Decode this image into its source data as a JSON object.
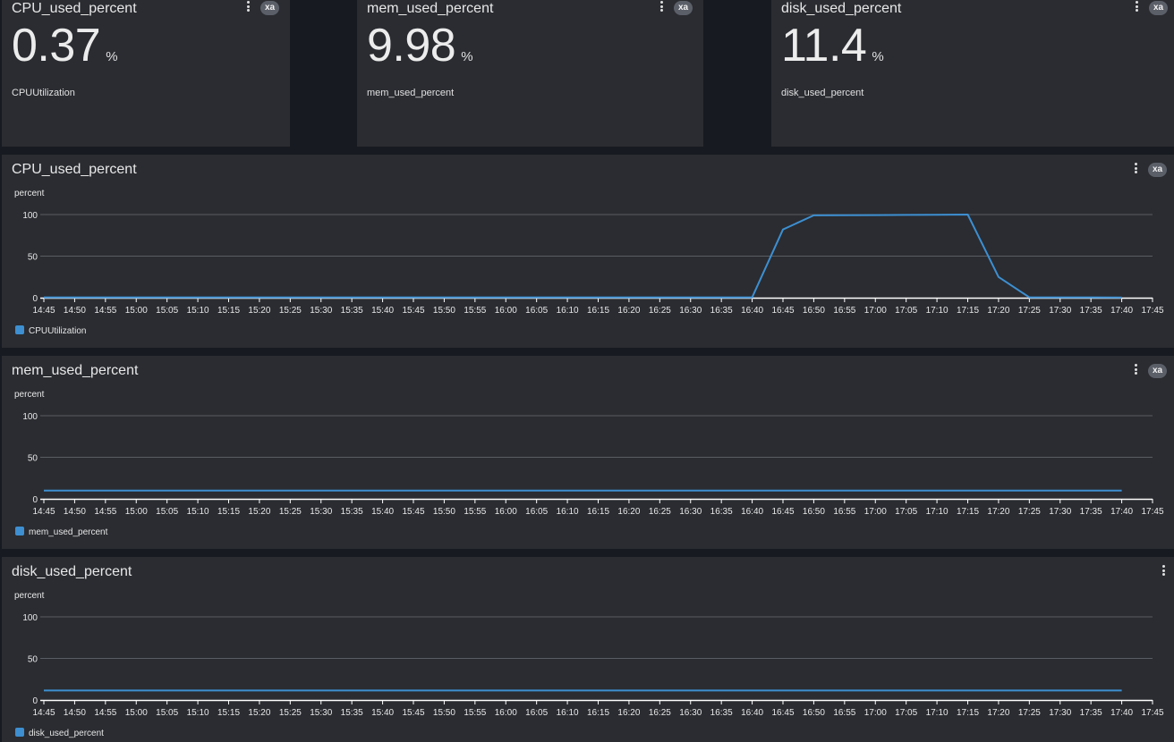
{
  "stat_panels": [
    {
      "title": "CPU_used_percent",
      "value": "0.37",
      "unit": "%",
      "subtitle": "CPUUtilization",
      "badge": "xa"
    },
    {
      "title": "mem_used_percent",
      "value": "9.98",
      "unit": "%",
      "subtitle": "mem_used_percent",
      "badge": "xa"
    },
    {
      "title": "disk_used_percent",
      "value": "11.4",
      "unit": "%",
      "subtitle": "disk_used_percent",
      "badge": "xa"
    }
  ],
  "colors": {
    "background": "#171a20",
    "panel": "#2a2c31",
    "series": "#3d8fd1",
    "grid": "#5a5d63",
    "axis": "#ffffff"
  },
  "chart_panels": [
    {
      "title": "CPU_used_percent",
      "badge": "xa",
      "legend": "CPUUtilization"
    },
    {
      "title": "mem_used_percent",
      "badge": "xa",
      "legend": "mem_used_percent"
    },
    {
      "title": "disk_used_percent",
      "badge": "",
      "legend": "disk_used_percent"
    }
  ],
  "chart_data": [
    {
      "type": "line",
      "ylabel": "percent",
      "ylim": [
        0,
        100
      ],
      "yticks": [
        0,
        50,
        100
      ],
      "grid": true,
      "legend": "bottom-left",
      "xticks": [
        "14:45",
        "14:50",
        "14:55",
        "15:00",
        "15:05",
        "15:10",
        "15:15",
        "15:20",
        "15:25",
        "15:30",
        "15:35",
        "15:40",
        "15:45",
        "15:50",
        "15:55",
        "16:00",
        "16:05",
        "16:10",
        "16:15",
        "16:20",
        "16:25",
        "16:30",
        "16:35",
        "16:40",
        "16:45",
        "16:50",
        "16:55",
        "17:00",
        "17:05",
        "17:10",
        "17:15",
        "17:20",
        "17:25",
        "17:30",
        "17:35",
        "17:40",
        "17:45"
      ],
      "series": [
        {
          "name": "CPUUtilization",
          "x": [
            "14:45",
            "14:50",
            "14:55",
            "15:00",
            "15:05",
            "15:10",
            "15:15",
            "15:20",
            "15:25",
            "15:30",
            "15:35",
            "15:40",
            "15:45",
            "15:50",
            "15:55",
            "16:00",
            "16:05",
            "16:10",
            "16:15",
            "16:20",
            "16:25",
            "16:30",
            "16:35",
            "16:40",
            "16:45",
            "16:50",
            "16:55",
            "17:00",
            "17:05",
            "17:10",
            "17:15",
            "17:20",
            "17:25",
            "17:30",
            "17:35",
            "17:40"
          ],
          "values": [
            0.4,
            0.4,
            0.4,
            0.4,
            0.4,
            0.4,
            0.4,
            0.4,
            0.4,
            0.4,
            0.4,
            0.4,
            0.4,
            0.4,
            0.4,
            0.4,
            0.4,
            0.4,
            0.4,
            0.4,
            0.4,
            0.4,
            0.4,
            0.4,
            82,
            99,
            99.2,
            99.4,
            99.6,
            99.8,
            100,
            25,
            0.4,
            0.4,
            0.4,
            0.37
          ]
        }
      ]
    },
    {
      "type": "line",
      "ylabel": "percent",
      "ylim": [
        0,
        100
      ],
      "yticks": [
        0,
        50,
        100
      ],
      "grid": true,
      "legend": "bottom-left",
      "xticks": [
        "14:45",
        "14:50",
        "14:55",
        "15:00",
        "15:05",
        "15:10",
        "15:15",
        "15:20",
        "15:25",
        "15:30",
        "15:35",
        "15:40",
        "15:45",
        "15:50",
        "15:55",
        "16:00",
        "16:05",
        "16:10",
        "16:15",
        "16:20",
        "16:25",
        "16:30",
        "16:35",
        "16:40",
        "16:45",
        "16:50",
        "16:55",
        "17:00",
        "17:05",
        "17:10",
        "17:15",
        "17:20",
        "17:25",
        "17:30",
        "17:35",
        "17:40",
        "17:45"
      ],
      "series": [
        {
          "name": "mem_used_percent",
          "x": [
            "14:45",
            "17:40"
          ],
          "values": [
            9.98,
            9.98
          ]
        }
      ]
    },
    {
      "type": "line",
      "ylabel": "percent",
      "ylim": [
        0,
        100
      ],
      "yticks": [
        0,
        50,
        100
      ],
      "grid": true,
      "legend": "bottom-left",
      "xticks": [
        "14:45",
        "14:50",
        "14:55",
        "15:00",
        "15:05",
        "15:10",
        "15:15",
        "15:20",
        "15:25",
        "15:30",
        "15:35",
        "15:40",
        "15:45",
        "15:50",
        "15:55",
        "16:00",
        "16:05",
        "16:10",
        "16:15",
        "16:20",
        "16:25",
        "16:30",
        "16:35",
        "16:40",
        "16:45",
        "16:50",
        "16:55",
        "17:00",
        "17:05",
        "17:10",
        "17:15",
        "17:20",
        "17:25",
        "17:30",
        "17:35",
        "17:40",
        "17:45"
      ],
      "series": [
        {
          "name": "disk_used_percent",
          "x": [
            "14:45",
            "17:40"
          ],
          "values": [
            11.4,
            11.4
          ]
        }
      ]
    }
  ]
}
